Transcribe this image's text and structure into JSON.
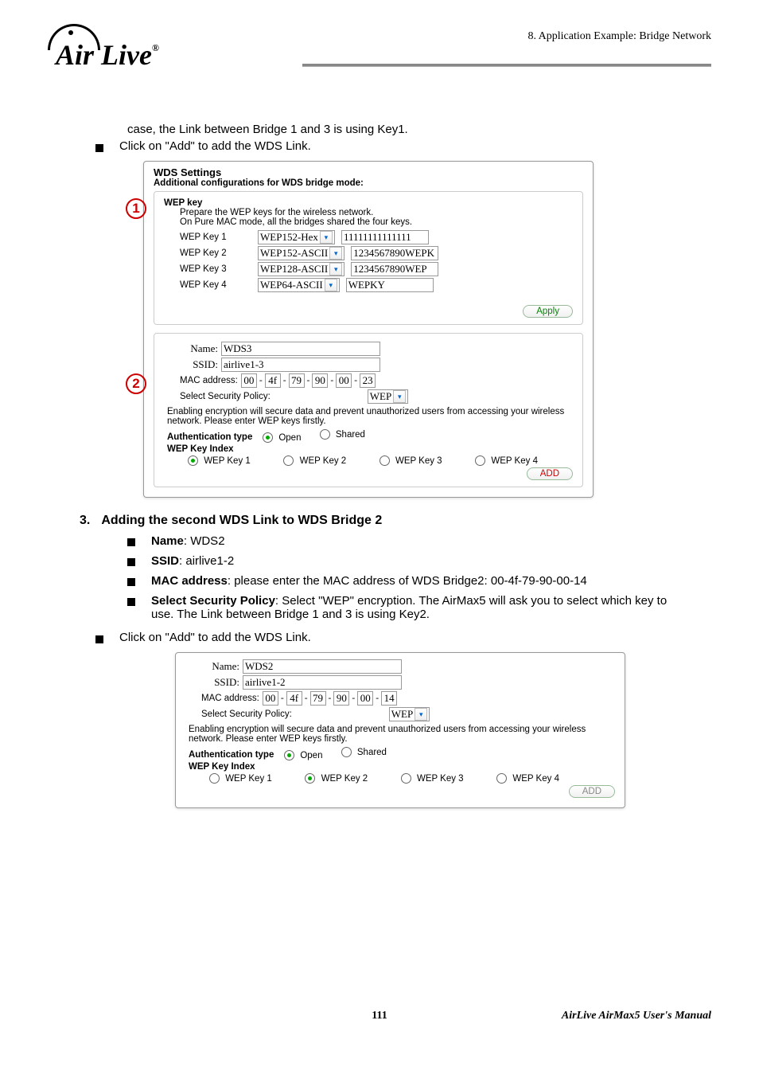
{
  "header": {
    "logo_text": "Air Live",
    "reg": "®",
    "crumb": "8.  Application  Example:  Bridge  Network"
  },
  "intro": {
    "line1": "case, the Link between Bridge 1 and 3 is using Key1.",
    "bullet1": "Click on \"Add\" to add the WDS Link."
  },
  "wds": {
    "title": "WDS Settings",
    "sub": "Additional configurations for WDS bridge mode:",
    "wep": {
      "label": "WEP key",
      "p1": "Prepare the WEP keys for the wireless network.",
      "p2": "On Pure MAC mode, all the bridges shared the four keys.",
      "rows": [
        {
          "label": "WEP Key 1",
          "type": "WEP152-Hex",
          "val": "11111111111111"
        },
        {
          "label": "WEP Key 2",
          "type": "WEP152-ASCII",
          "val": "1234567890WEPK"
        },
        {
          "label": "WEP Key 3",
          "type": "WEP128-ASCII",
          "val": "1234567890WEP"
        },
        {
          "label": "WEP Key 4",
          "type": "WEP64-ASCII",
          "val": "WEPKY"
        }
      ],
      "apply": "Apply"
    },
    "form1": {
      "name_label": "Name:",
      "name": "WDS3",
      "ssid_label": "SSID:",
      "ssid": "airlive1-3",
      "mac_label": "MAC address:",
      "mac": [
        "00",
        "4f",
        "79",
        "90",
        "00",
        "23"
      ],
      "pol_label": "Select Security Policy:",
      "pol": "WEP",
      "note": "Enabling encryption will secure data and prevent unauthorized users from accessing your wireless network. Please enter WEP keys firstly.",
      "auth_label": "Authentication type",
      "auth_open": "Open",
      "auth_shared": "Shared",
      "idx_label": "WEP Key Index",
      "keys": [
        "WEP Key 1",
        "WEP Key 2",
        "WEP Key 3",
        "WEP Key 4"
      ],
      "add": "ADD"
    }
  },
  "sec3": {
    "num": "3.",
    "title": "Adding the second WDS Link to WDS Bridge 2",
    "name_l": "Name",
    "name_v": ": WDS2",
    "ssid_l": "SSID",
    "ssid_v": ": airlive1-2",
    "mac_l": "MAC address",
    "mac_v": ": please enter the MAC address of WDS Bridge2: 00-4f-79-90-00-14",
    "pol_l": "Select Security Policy",
    "pol_v": ":   Select \"WEP\" encryption.   The AirMax5 will ask you to select which key to use.   The Link between Bridge 1 and 3 is using Key2.",
    "bullet2": "Click on \"Add\" to add the WDS Link."
  },
  "shot2": {
    "name_label": "Name:",
    "name": "WDS2",
    "ssid_label": "SSID:",
    "ssid": "airlive1-2",
    "mac_label": "MAC address:",
    "mac": [
      "00",
      "4f",
      "79",
      "90",
      "00",
      "14"
    ],
    "pol_label": "Select Security Policy:",
    "pol": "WEP",
    "note": "Enabling encryption will secure data and prevent unauthorized users from accessing your wireless network. Please enter WEP keys firstly.",
    "auth_label": "Authentication type",
    "auth_open": "Open",
    "auth_shared": "Shared",
    "idx_label": "WEP Key Index",
    "keys": [
      "WEP Key 1",
      "WEP Key 2",
      "WEP Key 3",
      "WEP Key 4"
    ],
    "add": "ADD"
  },
  "footer": {
    "page": "111",
    "manual": "AirLive  AirMax5  User's  Manual"
  }
}
